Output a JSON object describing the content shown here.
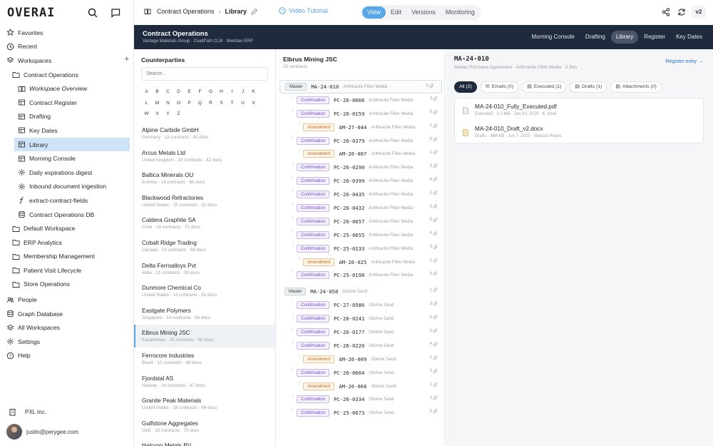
{
  "logo": "OVERAI",
  "sidebar": {
    "items": [
      {
        "label": "Favorites",
        "icon": "star-icon",
        "level": 0
      },
      {
        "label": "Recent",
        "icon": "clock-icon",
        "level": 0
      },
      {
        "label": "Workspaces",
        "icon": "layers-icon",
        "level": 0,
        "add": "+"
      },
      {
        "label": "Contract Operations",
        "icon": "folder-icon",
        "level": 1
      },
      {
        "label": "Workspace Overview",
        "icon": "book-icon",
        "level": 2,
        "italic": true
      },
      {
        "label": "Contract Register",
        "icon": "table-icon",
        "level": 2
      },
      {
        "label": "Drafting",
        "icon": "table-icon",
        "level": 2
      },
      {
        "label": "Key Dates",
        "icon": "table-icon",
        "level": 2
      },
      {
        "label": "Library",
        "icon": "table-icon",
        "level": 2,
        "active": true
      },
      {
        "label": "Morning Console",
        "icon": "table-icon",
        "level": 2
      },
      {
        "label": "Daily expirations digest",
        "icon": "gear-icon",
        "level": 2
      },
      {
        "label": "Inbound document ingestion",
        "icon": "gear-icon",
        "level": 2
      },
      {
        "label": "extract-contract-fields",
        "icon": "function-icon",
        "level": 2
      },
      {
        "label": "Contract Operations DB",
        "icon": "database-icon",
        "level": 2
      },
      {
        "label": "Default Workspace",
        "icon": "folder-icon",
        "level": 1
      },
      {
        "label": "ERP Analytics",
        "icon": "folder-icon",
        "level": 1
      },
      {
        "label": "Membership Management",
        "icon": "folder-icon",
        "level": 1
      },
      {
        "label": "Patient Visit Lifecycle",
        "icon": "folder-icon",
        "level": 1
      },
      {
        "label": "Store Operations",
        "icon": "folder-icon",
        "level": 1
      },
      {
        "label": "People",
        "icon": "people-icon",
        "level": 0
      },
      {
        "label": "Graph Database",
        "icon": "database-icon",
        "level": 0
      },
      {
        "label": "All Workspaces",
        "icon": "layers-icon",
        "level": 0
      },
      {
        "label": "Settings",
        "icon": "gear-icon",
        "level": 0
      },
      {
        "label": "Help",
        "icon": "help-icon",
        "level": 0
      }
    ],
    "org": "PXL Inc.",
    "user": "justin@perygee.com"
  },
  "topbar": {
    "breadcrumb_parent": "Contract Operations",
    "breadcrumb_current": "Library",
    "video_tutorial": "Video Tutorial",
    "modes": [
      "View",
      "Edit",
      "Versions",
      "Monitoring"
    ],
    "active_mode": "View",
    "version": "v2"
  },
  "header": {
    "title": "Contract Operations",
    "subtitle": "Vantage Materials Group · CoaltPath CLM · Meridian ERP",
    "tabs": [
      "Morning Console",
      "Drafting",
      "Library",
      "Register",
      "Key Dates"
    ],
    "active_tab": "Library"
  },
  "counterparties": {
    "title": "Counterparties",
    "search_placeholder": "Search...",
    "letters": [
      "A",
      "B",
      "C",
      "D",
      "E",
      "F",
      "G",
      "H",
      "I",
      "J",
      "K",
      "L",
      "M",
      "N",
      "O",
      "P",
      "Q",
      "R",
      "S",
      "T",
      "U",
      "V",
      "W",
      "X",
      "Y",
      "Z"
    ],
    "items": [
      {
        "name": "Alpine Carbide GmbH",
        "meta": "Germany · 13 contracts · 45 docs"
      },
      {
        "name": "Arcus Metals Ltd",
        "meta": "United Kingdom · 10 contracts · 42 docs"
      },
      {
        "name": "Baltica Minerals OU",
        "meta": "Estonia · 14 contracts · 60 docs"
      },
      {
        "name": "Blackwood Refractories",
        "meta": "United States · 15 contracts · 52 docs"
      },
      {
        "name": "Caldera Graphite SA",
        "meta": "Chile · 19 contracts · 72 docs"
      },
      {
        "name": "Cobalt Ridge Trading",
        "meta": "Canada · 13 contracts · 48 docs"
      },
      {
        "name": "Delta Ferroalloys Pvt",
        "meta": "India · 21 contracts · 90 docs"
      },
      {
        "name": "Dunmore Chemical Co",
        "meta": "United States · 13 contracts · 51 docs"
      },
      {
        "name": "Eastgate Polymers",
        "meta": "Singapore · 14 contracts · 56 docs"
      },
      {
        "name": "Elbrus Mining JSC",
        "meta": "Kazakhstan · 25 contracts · 95 docs",
        "selected": true
      },
      {
        "name": "Ferrocore Industries",
        "meta": "Brazil · 12 contracts · 46 docs"
      },
      {
        "name": "Fjordstal AS",
        "meta": "Norway · 14 contracts · 47 docs"
      },
      {
        "name": "Granite Peak Materials",
        "meta": "United States · 16 contracts · 64 docs"
      },
      {
        "name": "Gulfstone Aggregates",
        "meta": "UAE · 20 contracts · 70 docs"
      },
      {
        "name": "Halcyon Metals BV",
        "meta": ""
      }
    ]
  },
  "contracts": {
    "title": "Elbrus Mining JSC",
    "subtitle": "25 contracts",
    "rows": [
      {
        "type": "Master",
        "code": "MA-24-010",
        "product": "Anthracite Filter Media",
        "count": "5",
        "level": 0,
        "selected": true
      },
      {
        "type": "Confirmation",
        "code": "PC-26-0666",
        "product": "Anthracite Filter Media",
        "count": "3",
        "level": 1
      },
      {
        "type": "Confirmation",
        "code": "PC-26-0159",
        "product": "Anthracite Filter Media",
        "count": "5",
        "level": 1
      },
      {
        "type": "Amendment",
        "code": "AM-27-044",
        "product": "Anthracite Filter Media",
        "count": "1",
        "level": 2
      },
      {
        "type": "Confirmation",
        "code": "PC-26-0379",
        "product": "Anthracite Filter Media",
        "count": "6",
        "level": 1
      },
      {
        "type": "Amendment",
        "code": "AM-26-007",
        "product": "Anthracite Filter Media",
        "count": "1",
        "level": 2
      },
      {
        "type": "Confirmation",
        "code": "PC-26-0290",
        "product": "Anthracite Filter Media",
        "count": "3",
        "level": 1
      },
      {
        "type": "Confirmation",
        "code": "PC-26-0399",
        "product": "Anthracite Filter Media",
        "count": "4",
        "level": 1
      },
      {
        "type": "Confirmation",
        "code": "PC-26-0435",
        "product": "Anthracite Filter Media",
        "count": "3",
        "level": 1
      },
      {
        "type": "Confirmation",
        "code": "PC-26-0432",
        "product": "Anthracite Filter Media",
        "count": "3",
        "level": 1
      },
      {
        "type": "Confirmation",
        "code": "PC-26-0657",
        "product": "Anthracite Filter Media",
        "count": "5",
        "level": 1
      },
      {
        "type": "Confirmation",
        "code": "PC-25-0655",
        "product": "Anthracite Filter Media",
        "count": "4",
        "level": 1
      },
      {
        "type": "Confirmation",
        "code": "PC-25-0133",
        "product": "Anthracite Filter Media",
        "count": "3",
        "level": 1
      },
      {
        "type": "Amendment",
        "code": "AM-26-025",
        "product": "Anthracite Filter Media",
        "count": "1",
        "level": 2
      },
      {
        "type": "Confirmation",
        "code": "PC-25-0198",
        "product": "Anthracite Filter Media",
        "count": "3",
        "level": 1
      },
      {
        "type": "Master",
        "code": "MA-24-058",
        "product": "Olivine Sand",
        "count": "2",
        "level": 0,
        "gap": true
      },
      {
        "type": "Confirmation",
        "code": "PC-27-0586",
        "product": "Olivine Sand",
        "count": "3",
        "level": 1
      },
      {
        "type": "Confirmation",
        "code": "PC-26-0241",
        "product": "Olivine Sand",
        "count": "4",
        "level": 1
      },
      {
        "type": "Confirmation",
        "code": "PC-26-0177",
        "product": "Olivine Sand",
        "count": "3",
        "level": 1
      },
      {
        "type": "Confirmation",
        "code": "PC-26-0220",
        "product": "Olivine Sand",
        "count": "4",
        "level": 1
      },
      {
        "type": "Amendment",
        "code": "AM-26-009",
        "product": "Olivine Sand",
        "count": "1",
        "level": 2
      },
      {
        "type": "Confirmation",
        "code": "PC-26-0604",
        "product": "Olivine Sand",
        "count": "3",
        "level": 1
      },
      {
        "type": "Amendment",
        "code": "AM-26-068",
        "product": "Olivine Sand",
        "count": "1",
        "level": 2
      },
      {
        "type": "Confirmation",
        "code": "PC-26-0334",
        "product": "Olivine Sand",
        "count": "3",
        "level": 1
      },
      {
        "type": "Confirmation",
        "code": "PC-25-0673",
        "product": "Olivine Sand",
        "count": "3",
        "level": 1
      }
    ]
  },
  "detail": {
    "title": "MA-24-010",
    "subtitle": "Master Purchase Agreement · Anthracite Filter Media · 2 files",
    "register_link": "Register entry →",
    "tabs": [
      {
        "label": "All (2)",
        "active": true
      },
      {
        "label": "Emails (0)",
        "icon": "email-icon"
      },
      {
        "label": "Executed (1)",
        "icon": "document-icon"
      },
      {
        "label": "Drafts (1)",
        "icon": "document-icon"
      },
      {
        "label": "Attachments (0)",
        "icon": "document-icon"
      }
    ],
    "files": [
      {
        "name": "MA-24-010_Fully_Executed.pdf",
        "meta": "Executed · 2.1 MB · Jun 10, 2025 · K. Osei",
        "icon": "pdf-file-icon"
      },
      {
        "name": "MA-24-010_Draft_v2.docx",
        "meta": "Drafts · 348 KB · Jun 7, 2025 · Marcus Reyes",
        "icon": "doc-file-icon"
      }
    ]
  },
  "colors": {
    "accent": "#57a6e8",
    "dark_header": "#1f2a3d",
    "selected_nav": "#cfe3f7"
  }
}
